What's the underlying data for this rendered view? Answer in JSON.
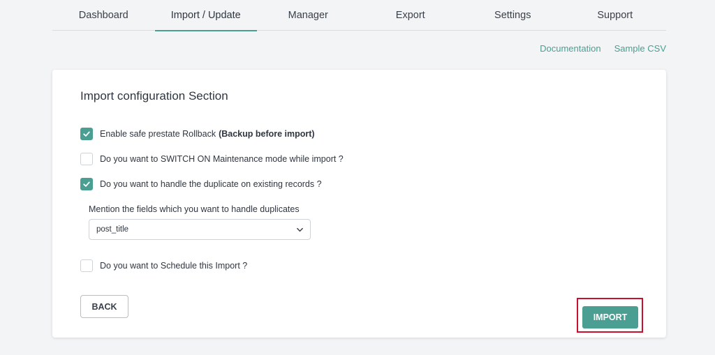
{
  "tabs": [
    {
      "label": "Dashboard"
    },
    {
      "label": "Import / Update"
    },
    {
      "label": "Manager"
    },
    {
      "label": "Export"
    },
    {
      "label": "Settings"
    },
    {
      "label": "Support"
    }
  ],
  "active_tab": "Import / Update",
  "links": {
    "documentation": "Documentation",
    "sample_csv": "Sample CSV"
  },
  "section": {
    "title": "Import configuration Section",
    "options": [
      {
        "label": "Enable safe prestate Rollback",
        "emphasis": "(Backup before import)",
        "checked": true
      },
      {
        "label": "Do you want to SWITCH ON Maintenance mode while import ?",
        "checked": false
      },
      {
        "label": "Do you want to handle the duplicate on existing records ?",
        "checked": true
      },
      {
        "label": "Do you want to Schedule this Import ?",
        "checked": false
      }
    ],
    "duplicate_label": "Mention the fields which you want to handle duplicates",
    "duplicate_field": "post_title"
  },
  "buttons": {
    "back": "BACK",
    "import": "IMPORT"
  },
  "colors": {
    "accent": "#4a9e92",
    "highlight": "#c8102e"
  }
}
